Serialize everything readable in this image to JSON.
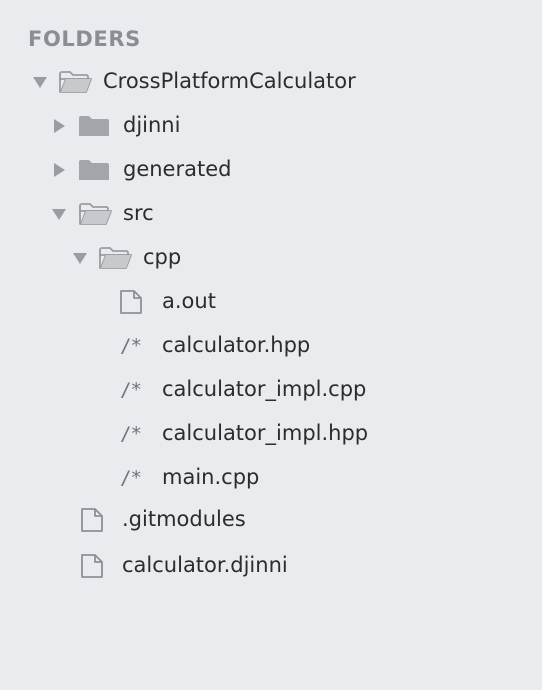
{
  "sidebar": {
    "header": "FOLDERS",
    "items": [
      {
        "label": "CrossPlatformCalculator",
        "type": "folder",
        "state": "open",
        "icon": "folder-open-icon"
      },
      {
        "label": "djinni",
        "type": "folder",
        "state": "closed",
        "icon": "folder-closed-icon"
      },
      {
        "label": "generated",
        "type": "folder",
        "state": "closed",
        "icon": "folder-closed-icon"
      },
      {
        "label": "src",
        "type": "folder",
        "state": "open",
        "icon": "folder-open-icon"
      },
      {
        "label": "cpp",
        "type": "folder",
        "state": "open",
        "icon": "folder-open-icon"
      },
      {
        "label": "a.out",
        "type": "file",
        "icon": "file-icon"
      },
      {
        "label": "calculator.hpp",
        "type": "source",
        "icon": "comment-icon",
        "glyph": "/*"
      },
      {
        "label": "calculator_impl.cpp",
        "type": "source",
        "icon": "comment-icon",
        "glyph": "/*"
      },
      {
        "label": "calculator_impl.hpp",
        "type": "source",
        "icon": "comment-icon",
        "glyph": "/*"
      },
      {
        "label": "main.cpp",
        "type": "source",
        "icon": "comment-icon",
        "glyph": "/*"
      },
      {
        "label": ".gitmodules",
        "type": "file",
        "icon": "file-icon"
      },
      {
        "label": "calculator.djinni",
        "type": "file",
        "icon": "file-icon"
      }
    ]
  },
  "colors": {
    "background": "#e9ebee",
    "header_text": "#8a8d93",
    "item_text": "#2c2c2c",
    "icon_gray": "#9a9ca1"
  }
}
